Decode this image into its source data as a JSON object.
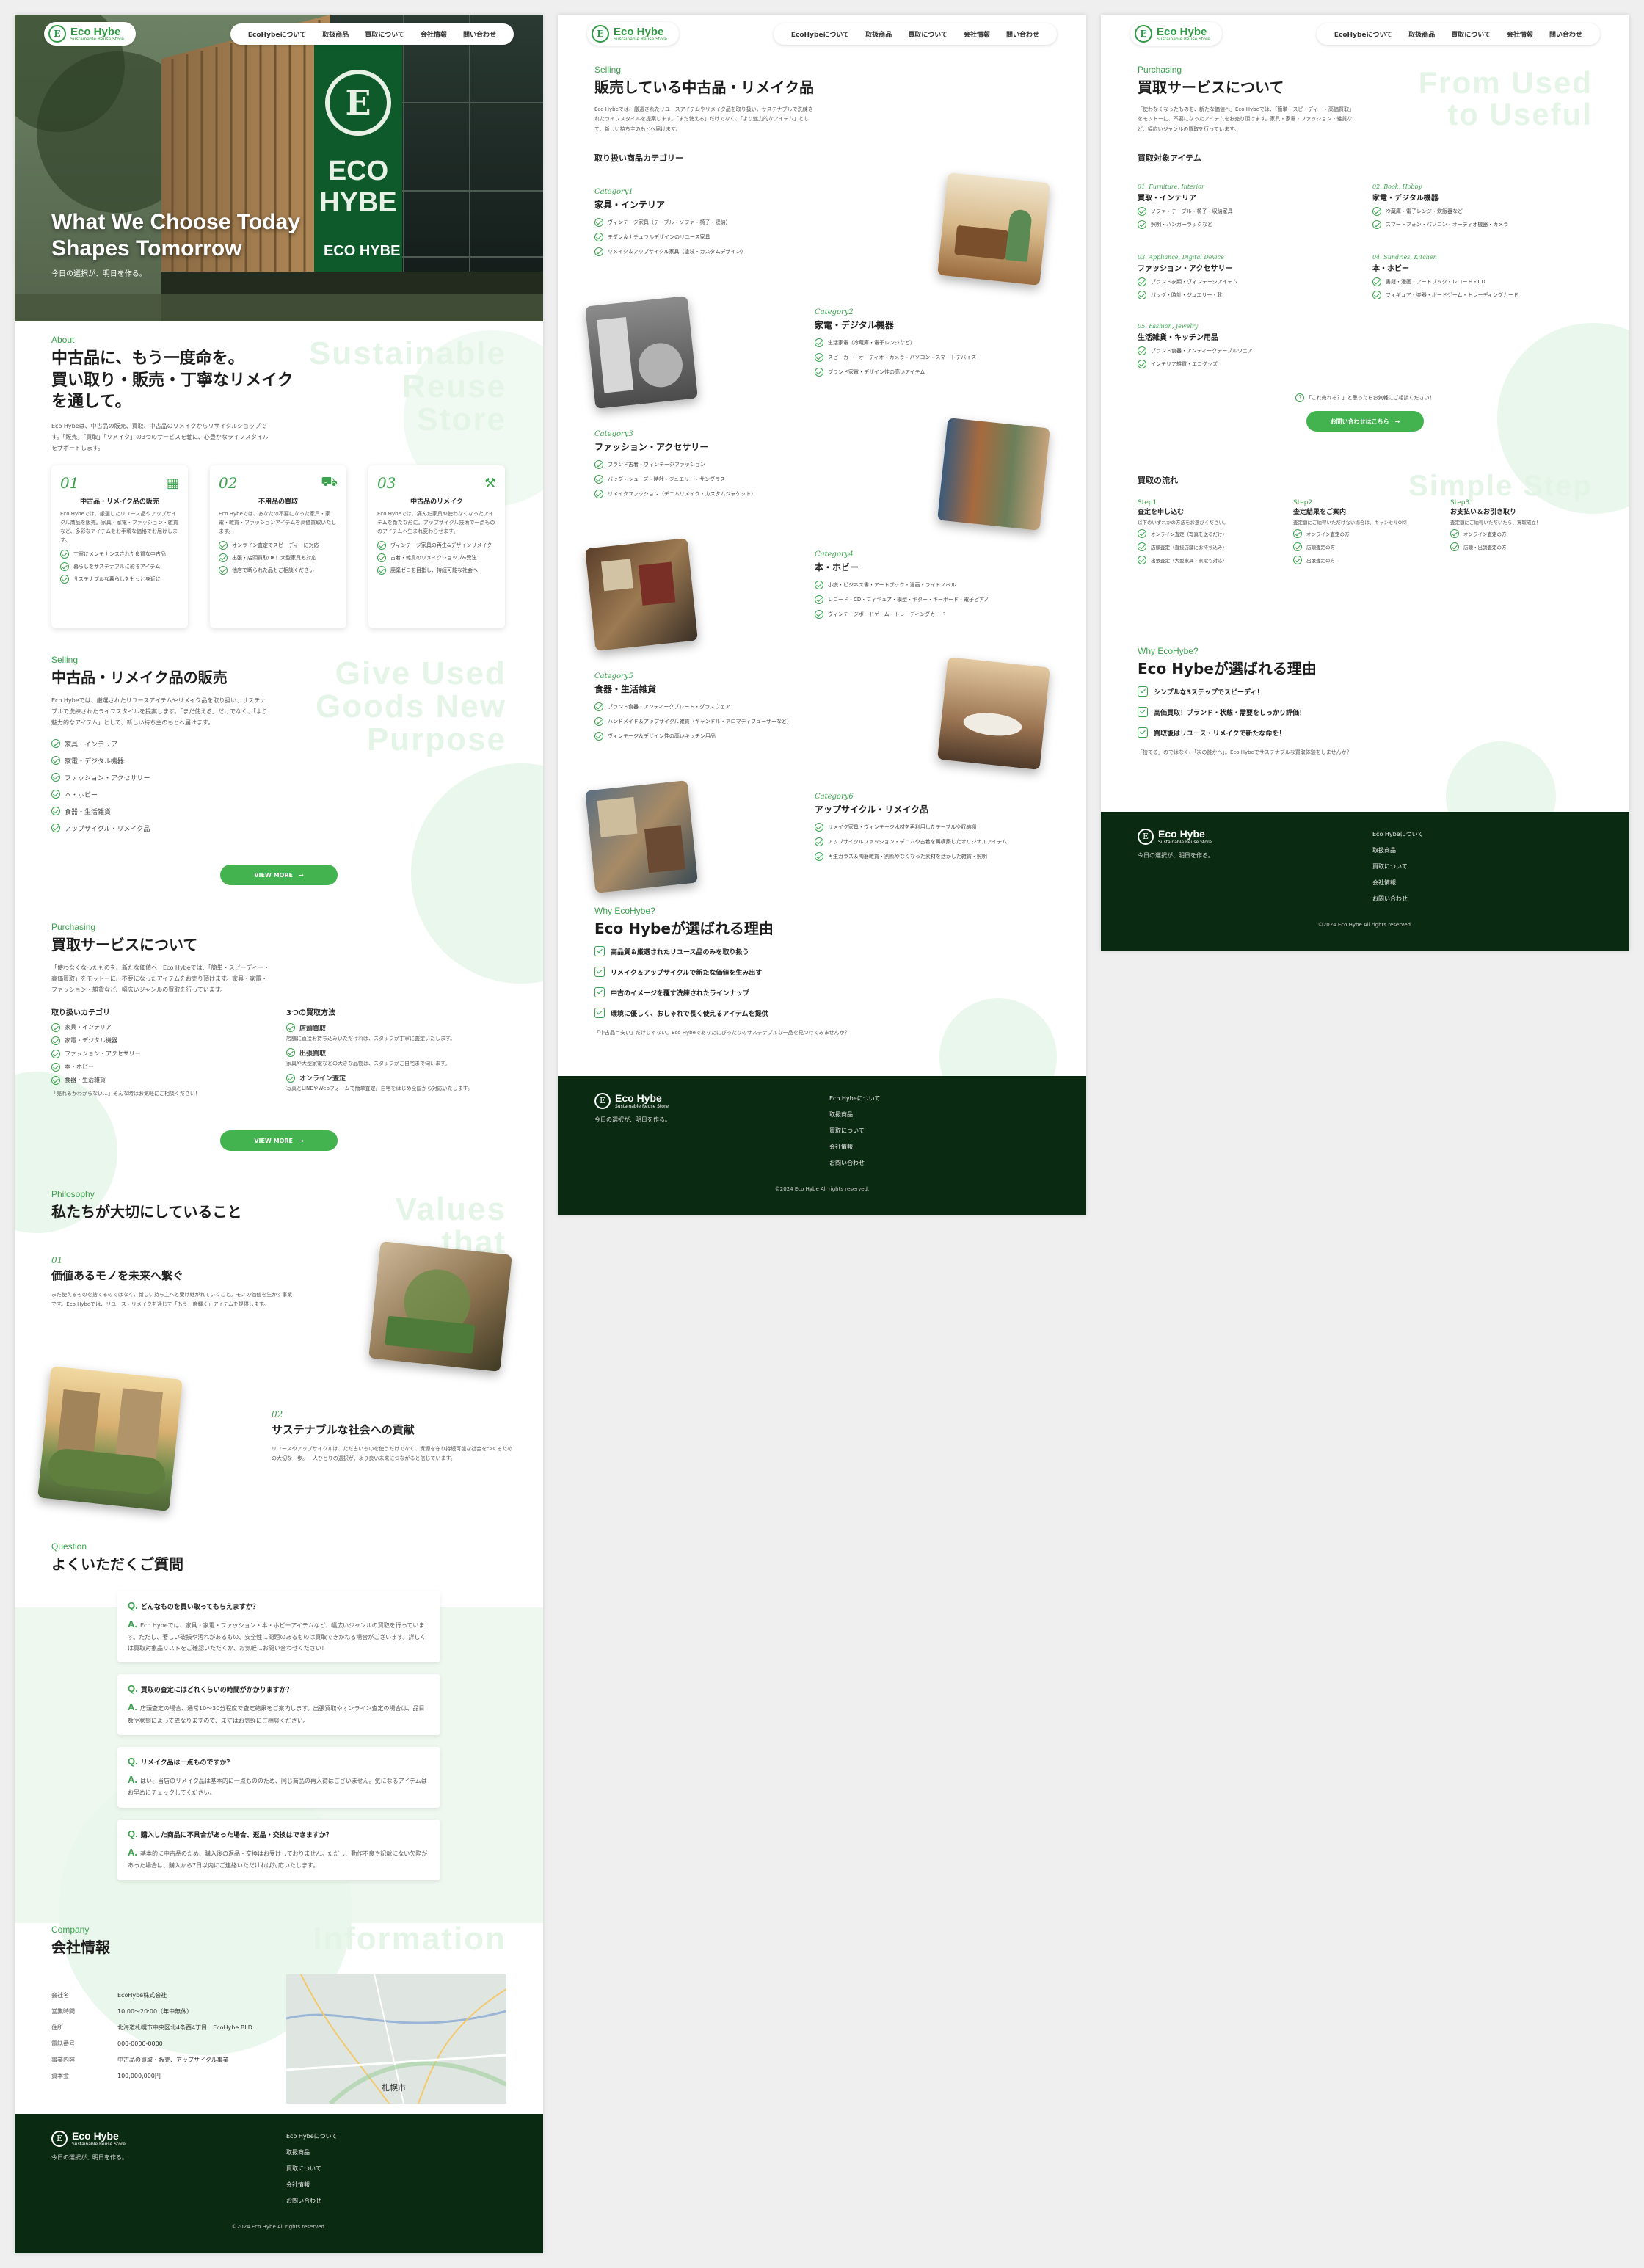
{
  "brand": {
    "name": "Eco Hybe",
    "tagline": "Sustainable Reuse Store"
  },
  "nav": [
    "EcoHybeについて",
    "取扱商品",
    "買取について",
    "会社情報",
    "問い合わせ"
  ],
  "hero": {
    "title_line1": "What We Choose Today",
    "title_line2": "Shapes Tomorrow",
    "subtitle": "今日の選択が、明日を作る。",
    "building_sign": "ECO HYBE",
    "building_sign2": "ECO HYBE"
  },
  "about": {
    "en": "About",
    "title_l1": "中古品に、もう一度命を。",
    "title_l2": "買い取り・販売・丁寧なリメイク",
    "title_l3": "を通して。",
    "bg": [
      "Sustainable",
      "Reuse",
      "Store"
    ],
    "body": "Eco Hybeは、中古品の販売、買取、中古品のリメイクからリサイクルショップです。「販売」「買取」「リメイク」の3つのサービスを軸に、心豊かなライフスタイルをサポートします。",
    "cards": [
      {
        "num": "01",
        "title": "中古品・リメイク品の販売",
        "body": "Eco Hybeでは、厳選したリユース品やアップサイクル商品を販売。家具・家電・ファッション・雑貨など、多彩なアイテムをお手頃な価格でお届けします。",
        "items": [
          "丁寧にメンテナンスされた良質な中古品",
          "暮らしをサステナブルに彩るアイテム",
          "サステナブルな暮らしをもっと身近に"
        ]
      },
      {
        "num": "02",
        "title": "不用品の買取",
        "body": "Eco Hybeでは、あなたの不要になった家具・家電・雑貨・ファッションアイテムを高価買取いたします。",
        "items": [
          "オンライン査定でスピーディーに対応",
          "出張・店頭買取OK！大型家具も対応",
          "他店で断られた品もご相談ください"
        ]
      },
      {
        "num": "03",
        "title": "中古品のリメイク",
        "body": "Eco Hybeでは、痛んだ家具や使わなくなったアイテムを新たな形に。アップサイクル技術で一点もののアイテムへ生まれ変わらせます。",
        "items": [
          "ヴィンテージ家具の再生&デザインリメイク",
          "古着・雑貨のリメイクショップ&受注",
          "廃棄ゼロを目指し、持続可能な社会へ"
        ]
      }
    ]
  },
  "selling": {
    "en": "Selling",
    "title": "中古品・リメイク品の販売",
    "bg": [
      "Give Used",
      "Goods New",
      "Purpose"
    ],
    "body": "Eco Hybeでは、厳選されたリユースアイテムやリメイク品を取り扱い、サステナブルで洗練されたライフスタイルを提案します。「まだ使える」だけでなく、「より魅力的なアイテム」として、新しい持ち主のもとへ届けます。",
    "items": [
      "家具・インテリア",
      "家電・デジタル機器",
      "ファッション・アクセサリー",
      "本・ホビー",
      "食器・生活雑貨",
      "アップサイクル・リメイク品"
    ],
    "btn": "VIEW MORE"
  },
  "purchasing": {
    "en": "Purchasing",
    "title": "買取サービスについて",
    "body": "「使わなくなったものを、新たな価値へ」Eco Hybeでは、「簡単・スピーディー・高価買取」をモットーに、不要になったアイテムをお売り頂けます。家具・家電・ファッション・雑貨など、幅広いジャンルの買取を行っています。",
    "cat_title": "取り扱いカテゴリ",
    "cats": [
      "家具・インテリア",
      "家電・デジタル機器",
      "ファッション・アクセサリー",
      "本・ホビー",
      "食器・生活雑貨"
    ],
    "note": "「売れるかわからない…」そんな時はお気軽にご相談ください！",
    "methods_title": "3つの買取方法",
    "methods": [
      {
        "t": "店頭買取",
        "d": "店舗に直接お持ち込みいただければ、スタッフが丁寧に査定いたします。"
      },
      {
        "t": "出張買取",
        "d": "家具や大型家電などの大きな品物は、スタッフがご自宅まで伺います。"
      },
      {
        "t": "オンライン査定",
        "d": "写真とLINEやWebフォームで簡単査定。自宅をはじめ全国から対応いたします。"
      }
    ],
    "btn": "VIEW MORE"
  },
  "philosophy": {
    "en": "Philosophy",
    "title": "私たちが大切にしていること",
    "bg": [
      "Values",
      "that",
      "a better"
    ],
    "items": [
      {
        "num": "01",
        "title": "価値あるモノを未来へ繋ぐ",
        "body": "まだ使えるものを捨てるのではなく、新しい持ち主へと受け継がれていくこと。モノの価値を生かす事業です。Eco Hybeでは、リユース・リメイクを通じて「もう一度輝く」アイテムを提供します。"
      },
      {
        "num": "02",
        "title": "サステナブルな社会への貢献",
        "body": "リユースやアップサイクルは、ただ古いものを使うだけでなく、資源を守り持続可能な社会をつくるための大切な一歩。一人ひとりの選択が、より良い未来につながると信じています。"
      }
    ]
  },
  "faq": {
    "en": "Question",
    "title": "よくいただくご質問",
    "items": [
      {
        "q": "どんなものを買い取ってもらえますか？",
        "a": "Eco Hybeでは、家具・家電・ファッション・本・ホビーアイテムなど、幅広いジャンルの買取を行っています。ただし、著しい破損や汚れがあるもの、安全性に問題のあるものは買取できかねる場合がございます。詳しくは買取対象品リストをご確認いただくか、お気軽にお問い合わせください！"
      },
      {
        "q": "買取の査定にはどれくらいの時間がかかりますか？",
        "a": "店頭査定の場合、通常10～30分程度で査定結果をご案内します。出張買取やオンライン査定の場合は、品目数や状態によって異なりますので、まずはお気軽にご相談ください。"
      },
      {
        "q": "リメイク品は一点ものですか？",
        "a": "はい、当店のリメイク品は基本的に一点もののため、同じ商品の再入荷はございません。気になるアイテムはお早めにチェックしてください。"
      },
      {
        "q": "購入した商品に不具合があった場合、返品・交換はできますか？",
        "a": "基本的に中古品のため、購入後の返品・交換はお受けしておりません。ただし、動作不良や記載にない欠陥があった場合は、購入から7日以内にご連絡いただければ対応いたします。"
      }
    ]
  },
  "company": {
    "en": "Company",
    "title": "会社情報",
    "bg": "Information",
    "rows": [
      {
        "k": "会社名",
        "v": "EcoHybe株式会社"
      },
      {
        "k": "営業時間",
        "v": "10:00～20:00（年中無休）"
      },
      {
        "k": "住所",
        "v": "北海道札幌市中央区北4条西4丁目　EcoHybe BLD."
      },
      {
        "k": "電話番号",
        "v": "000-0000-0000"
      },
      {
        "k": "事業内容",
        "v": "中古品の買取・販売、アップサイクル事業"
      },
      {
        "k": "資本金",
        "v": "100,000,000円"
      }
    ],
    "map_label": "札幌市"
  },
  "footer": {
    "tag": "今日の選択が、明日を作る。",
    "links": [
      "Eco Hybeについて",
      "取扱商品",
      "買取について",
      "会社情報",
      "お問い合わせ"
    ],
    "copy": "©2024 Eco Hybe All rights reserved."
  },
  "p2": {
    "en": "Selling",
    "title": "販売している中古品・リメイク品",
    "body": "Eco Hybeでは、厳選されたリユースアイテムやリメイク品を取り扱い、サステナブルで洗練されたライフスタイルを提案します。「まだ使える」だけでなく、「より魅力的なアイテム」として、新しい持ち主のもとへ届けます。",
    "sub": "取り扱い商品カテゴリー",
    "cats": [
      {
        "label": "Category1",
        "title": "家具・インテリア",
        "items": [
          "ヴィンテージ家具（テーブル・ソファ・椅子・収納）",
          "モダン＆ナチュラルデザインのリユース家具",
          "リメイク＆アップサイクル家具（塗装・カスタムデザイン）"
        ]
      },
      {
        "label": "Category2",
        "title": "家電・デジタル機器",
        "items": [
          "生活家電（冷蔵庫・電子レンジなど）",
          "スピーカー・オーディオ・カメラ・パソコン・スマートデバイス",
          "ブランド家電・デザイン性の高いアイテム"
        ]
      },
      {
        "label": "Category3",
        "title": "ファッション・アクセサリー",
        "items": [
          "ブランド古着・ヴィンテージファッション",
          "バッグ・シューズ・時計・ジュエリー・サングラス",
          "リメイクファッション（デニムリメイク・カスタムジャケット）"
        ]
      },
      {
        "label": "Category4",
        "title": "本・ホビー",
        "items": [
          "小説・ビジネス書・アートブック・漫画・ライトノベル",
          "レコード・CD・フィギュア・模型・ギター・キーボード・電子ピアノ",
          "ヴィンテージボードゲーム・トレーディングカード"
        ]
      },
      {
        "label": "Category5",
        "title": "食器・生活雑貨",
        "items": [
          "ブランド食器・アンティークプレート・グラスウェア",
          "ハンドメイド＆アップサイクル雑貨（キャンドル・アロマディフューザーなど）",
          "ヴィンテージ＆デザイン性の高いキッチン用品"
        ]
      },
      {
        "label": "Category6",
        "title": "アップサイクル・リメイク品",
        "items": [
          "リメイク家具・ヴィンテージ木材を再利用したテーブルや収納棚",
          "アップサイクルファッション・デニムや古着を再構築したオリジナルアイテム",
          "再生ガラス＆陶器雑貨・割れやなくなった素材を活かした雑貨・照明"
        ]
      }
    ],
    "why_en": "Why EcoHybe?",
    "why_title": "Eco Hybeが選ばれる理由",
    "reasons": [
      "高品質＆厳選されたリユース品のみを取り扱う",
      "リメイク＆アップサイクルで新たな価値を生み出す",
      "中古のイメージを覆す洗練されたラインナップ",
      "環境に優しく、おしゃれで長く使えるアイテムを提供"
    ],
    "closing": "「中古品＝安い」だけじゃない。Eco Hybeであなたにぴったりのサステナブルな一品を見つけてみませんか？"
  },
  "p3": {
    "en": "Purchasing",
    "title": "買取サービスについて",
    "bg": [
      "From Used",
      "to Useful"
    ],
    "body": "「使わなくなったものを、新たな価値へ」Eco Hybeでは、「簡単・スピーディー・高価買取」をモットーに、不要になったアイテムをお売り頂けます。家具・家電・ファッション・雑貨など、幅広いジャンルの買取を行っています。",
    "items_title": "買取対象アイテム",
    "cats": [
      {
        "label": "01. Furniture, Interior",
        "title": "買取・インテリア",
        "items": [
          "ソファ・テーブル・椅子・収納家具",
          "照明・ハンガーラックなど"
        ]
      },
      {
        "label": "02. Book, Hobby",
        "title": "家電・デジタル機器",
        "items": [
          "冷蔵庫・電子レンジ・炊飯器など",
          "スマートフォン・パソコン・オーディオ機器・カメラ"
        ]
      },
      {
        "label": "03. Appliance, Digital Device",
        "title": "ファッション・アクセサリー",
        "items": [
          "ブランド衣類・ヴィンテージアイテム",
          "バッグ・時計・ジュエリー・靴"
        ]
      },
      {
        "label": "04. Sundries, Kitchen",
        "title": "本・ホビー",
        "items": [
          "書籍・漫画・アートブック・レコード・CD",
          "フィギュア・楽器・ボードゲーム・トレーディングカード"
        ]
      },
      {
        "label": "05. Fashion, Jewelry",
        "title": "生活雑貨・キッチン用品",
        "items": [
          "ブランド食器・アンティークテーブルウェア",
          "インテリア雑貨・エコグッズ"
        ]
      }
    ],
    "ask": "「これ売れる？」と思ったらお気軽にご相談ください！",
    "btn": "お問い合わせはこちら",
    "flow_title": "買取の流れ",
    "flow_bg": "Simple Step",
    "steps": [
      {
        "n": "Step1",
        "t": "査定を申し込む",
        "d": "以下のいずれかの方法をお選びください。",
        "items": [
          "オンライン査定（写真を送るだけ）",
          "店頭査定（直接店舗にお持ち込み）",
          "出張査定（大型家具・家電も対応）"
        ]
      },
      {
        "n": "Step2",
        "t": "査定結果をご案内",
        "d": "査定額にご納得いただけない場合は、キャンセルOK！",
        "items": [
          "オンライン査定の方",
          "店頭査定の方",
          "出張査定の方"
        ]
      },
      {
        "n": "Step3",
        "t": "お支払い＆お引き取り",
        "d": "査定額にご納得いただいたら、買取成立！",
        "items": [
          "オンライン査定の方",
          "店頭・出張査定の方"
        ]
      }
    ],
    "why_en": "Why EcoHybe?",
    "why_title": "Eco Hybeが選ばれる理由",
    "reasons": [
      "シンプルな3ステップでスピーディ！",
      "高価買取！ブランド・状態・需要をしっかり評価！",
      "買取後はリユース・リメイクで新たな命を！"
    ],
    "closing": "「捨てる」のではなく、「次の誰かへ」。Eco Hybeでサステナブルな買取体験をしませんか？"
  },
  "colors": {
    "green": "#3aa24d",
    "footer": "#0b2a12",
    "light": "#eaf7ec"
  }
}
